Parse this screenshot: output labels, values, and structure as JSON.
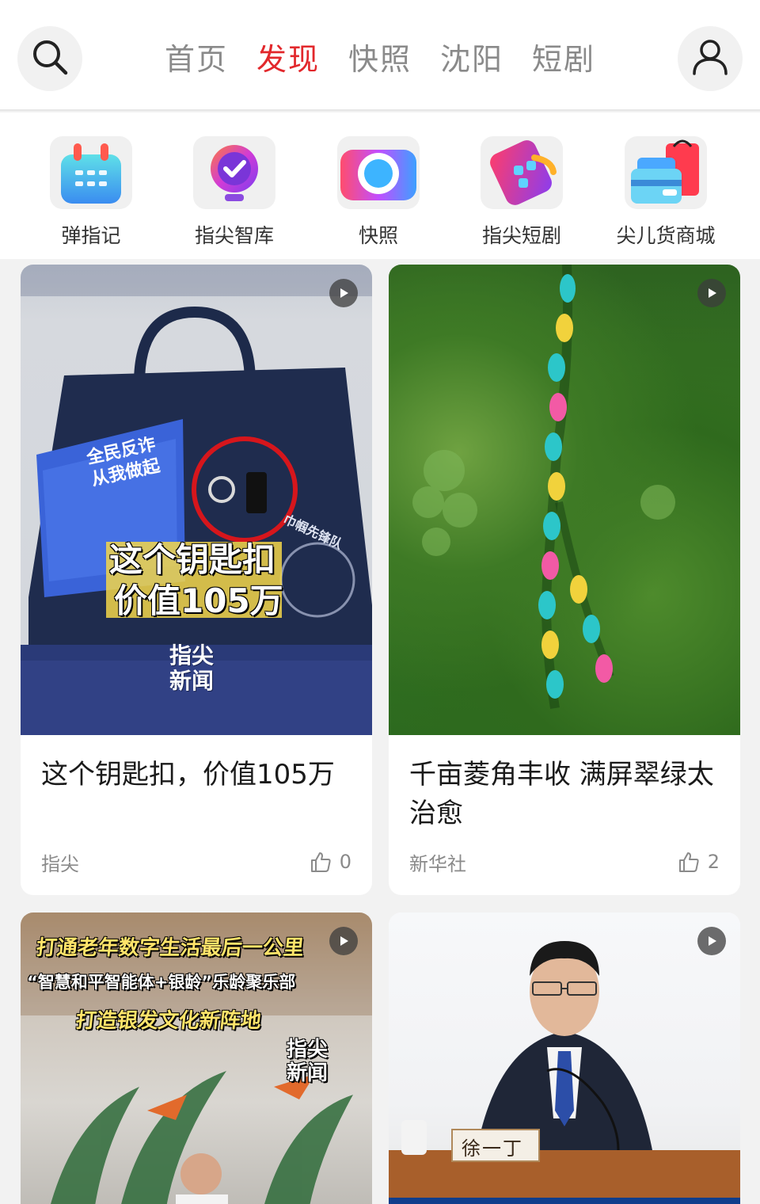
{
  "header": {
    "tabs": [
      {
        "label": "首页",
        "active": false
      },
      {
        "label": "发现",
        "active": true
      },
      {
        "label": "快照",
        "active": false
      },
      {
        "label": "沈阳",
        "active": false
      },
      {
        "label": "短剧",
        "active": false
      }
    ],
    "search_icon": "search-icon",
    "user_icon": "user-icon"
  },
  "quick_entries": [
    {
      "label": "弹指记",
      "icon": "calendar-app-icon"
    },
    {
      "label": "指尖智库",
      "icon": "bulb-check-app-icon"
    },
    {
      "label": "快照",
      "icon": "camera-app-icon"
    },
    {
      "label": "指尖短剧",
      "icon": "tablet-app-icon"
    },
    {
      "label": "尖儿货商城",
      "icon": "shopping-bag-app-icon"
    }
  ],
  "cards": [
    {
      "title": "这个钥匙扣，价值105万",
      "source": "指尖",
      "likes": "0",
      "cover_text": {
        "leaflet": "全民反诈\n从我做起",
        "line1": "这个钥匙扣",
        "line2": "价值105万",
        "brand": "指尖\n新闻",
        "badge_ring": "巾帼先锋队"
      }
    },
    {
      "title": "千亩菱角丰收 满屏翠绿太治愈",
      "source": "新华社",
      "likes": "2"
    },
    {
      "title": "",
      "cover_text": {
        "line1": "打通老年数字生活最后一公里",
        "line2": "“智慧和平智能体+银龄”乐龄聚乐部",
        "line3": "打造银发文化新阵地",
        "brand": "指尖\n新闻"
      }
    },
    {
      "title": "",
      "cover_text": {
        "nameplate": "徐一丁"
      }
    }
  ],
  "colors": {
    "accent": "#e2282c",
    "tab_inactive": "#8a8a8a"
  }
}
